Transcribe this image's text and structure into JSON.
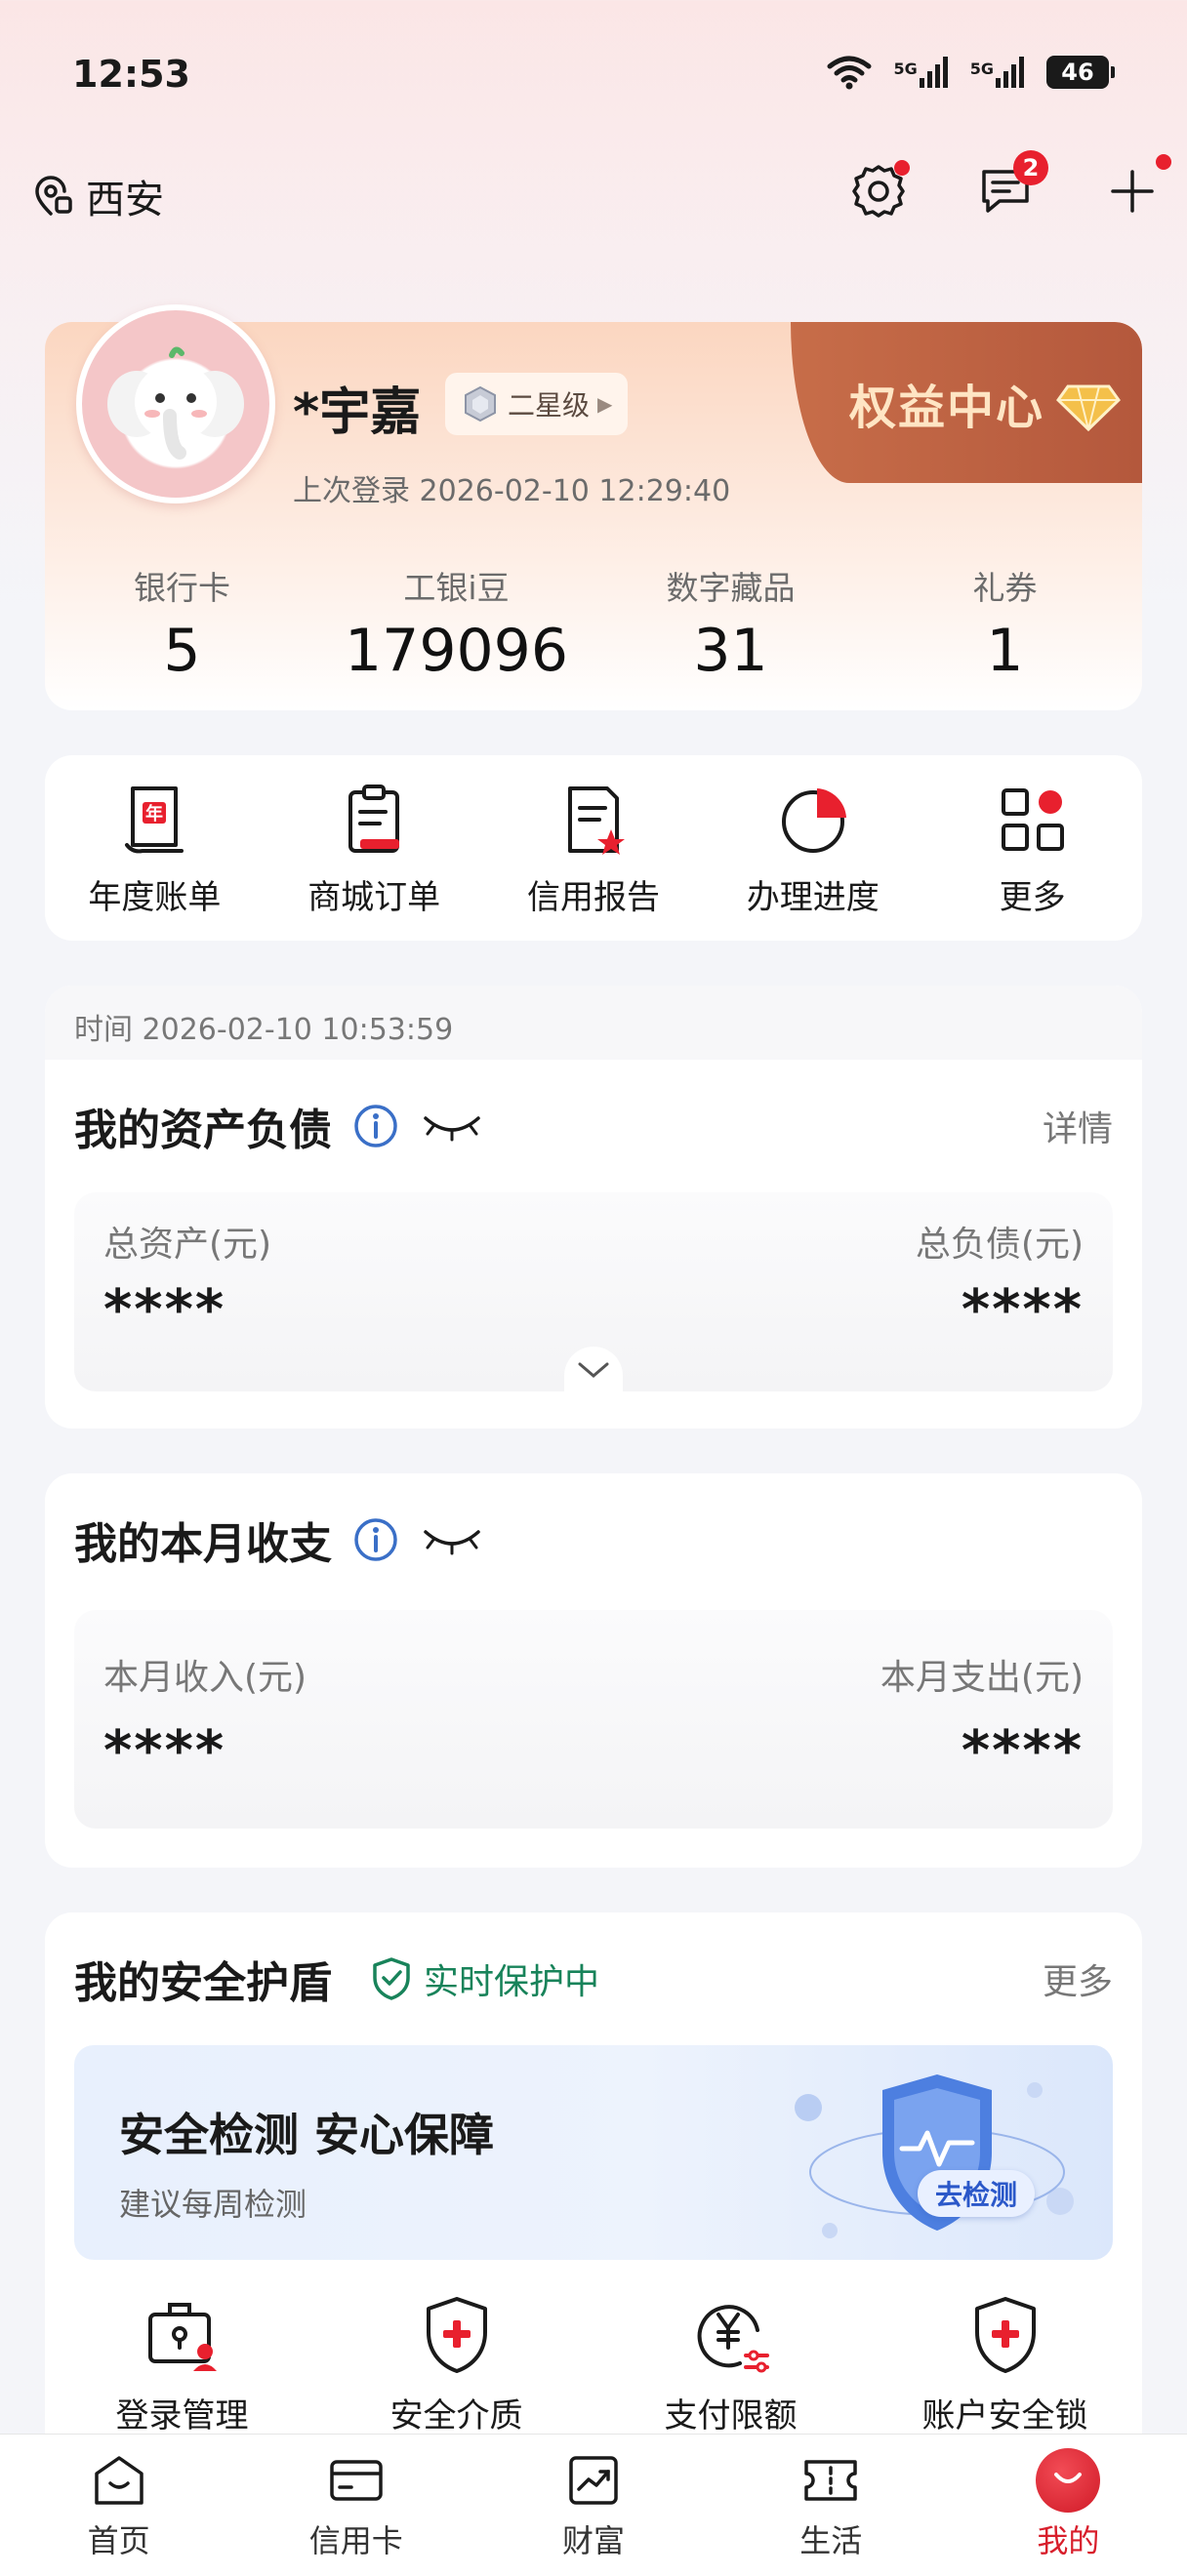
{
  "status_bar": {
    "time": "12:53",
    "network_1": "5G",
    "network_2": "5G",
    "battery": "46"
  },
  "header": {
    "location": "西安",
    "messages_badge": "2",
    "icons": [
      "location-icon",
      "settings-icon",
      "message-icon",
      "plus-icon"
    ]
  },
  "profile": {
    "name": "*宇嘉",
    "level": "二星级",
    "last_login": "上次登录 2026-02-10 12:29:40",
    "rights_center": "权益中心",
    "stats": [
      {
        "label": "银行卡",
        "value": "5"
      },
      {
        "label": "工银i豆",
        "value": "179096"
      },
      {
        "label": "数字藏品",
        "value": "31"
      },
      {
        "label": "礼券",
        "value": "1"
      }
    ]
  },
  "quick_actions": [
    {
      "label": "年度账单",
      "icon": "annual-bill-icon"
    },
    {
      "label": "商城订单",
      "icon": "mall-order-icon"
    },
    {
      "label": "信用报告",
      "icon": "credit-report-icon"
    },
    {
      "label": "办理进度",
      "icon": "progress-icon"
    },
    {
      "label": "更多",
      "icon": "more-grid-icon"
    }
  ],
  "assets": {
    "time": "时间 2026-02-10 10:53:59",
    "title": "我的资产负债",
    "detail_link": "详情",
    "total_assets_label": "总资产(元)",
    "total_assets_value": "****",
    "total_liabilities_label": "总负债(元)",
    "total_liabilities_value": "****"
  },
  "income": {
    "title": "我的本月收支",
    "income_label": "本月收入(元)",
    "income_value": "****",
    "expense_label": "本月支出(元)",
    "expense_value": "****"
  },
  "security": {
    "title": "我的安全护盾",
    "status": "实时保护中",
    "more_link": "更多",
    "banner_title": "安全检测 安心保障",
    "banner_subtitle": "建议每周检测",
    "detect_button": "去检测",
    "tools": [
      {
        "label": "登录管理"
      },
      {
        "label": "安全介质"
      },
      {
        "label": "支付限额"
      },
      {
        "label": "账户安全锁"
      }
    ]
  },
  "bottom_nav": [
    {
      "label": "首页",
      "icon": "home-icon"
    },
    {
      "label": "信用卡",
      "icon": "credit-card-icon"
    },
    {
      "label": "财富",
      "icon": "wealth-icon"
    },
    {
      "label": "生活",
      "icon": "life-ticket-icon"
    },
    {
      "label": "我的",
      "icon": "mine-icon",
      "active": true
    }
  ],
  "colors": {
    "brand_red": "#d81e2b",
    "protect_green": "#18835a",
    "info_blue": "#3a6fc7"
  }
}
